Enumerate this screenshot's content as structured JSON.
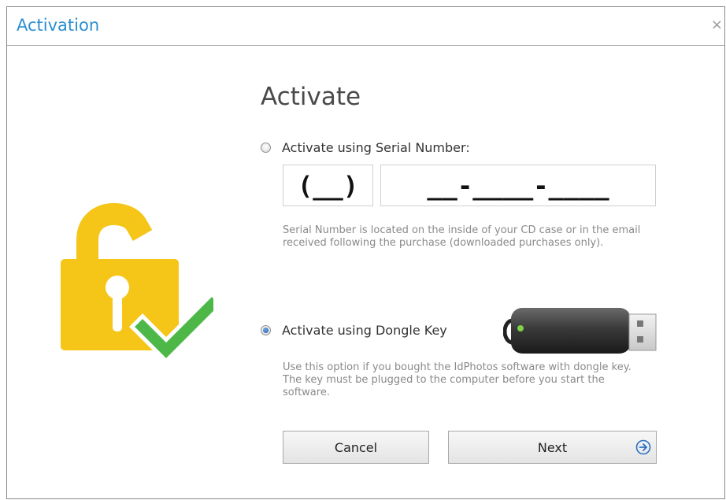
{
  "window": {
    "title": "Activation",
    "close_glyph": "×"
  },
  "main": {
    "heading": "Activate",
    "serial_option": {
      "label": "Activate using Serial Number:",
      "selected": false,
      "prefix_value": "(__)",
      "serial_value": "__-____-____",
      "hint": "Serial Number is located on the inside of your CD case or in the email received following the purchase (downloaded purchases only)."
    },
    "dongle_option": {
      "label": "Activate using Dongle Key",
      "selected": true,
      "hint": "Use this option if you bought the IdPhotos software with dongle key. The key must be plugged to the computer before you start the software."
    }
  },
  "buttons": {
    "cancel": "Cancel",
    "next": "Next"
  },
  "colors": {
    "title": "#2b8fd1",
    "lock": "#f5c518",
    "check": "#4db848",
    "next_icon": "#2b6fc4"
  },
  "icons": {
    "lock": "unlocked-padlock-icon",
    "check": "checkmark-icon",
    "dongle": "usb-dongle-icon",
    "next": "arrow-right-circle-icon"
  }
}
